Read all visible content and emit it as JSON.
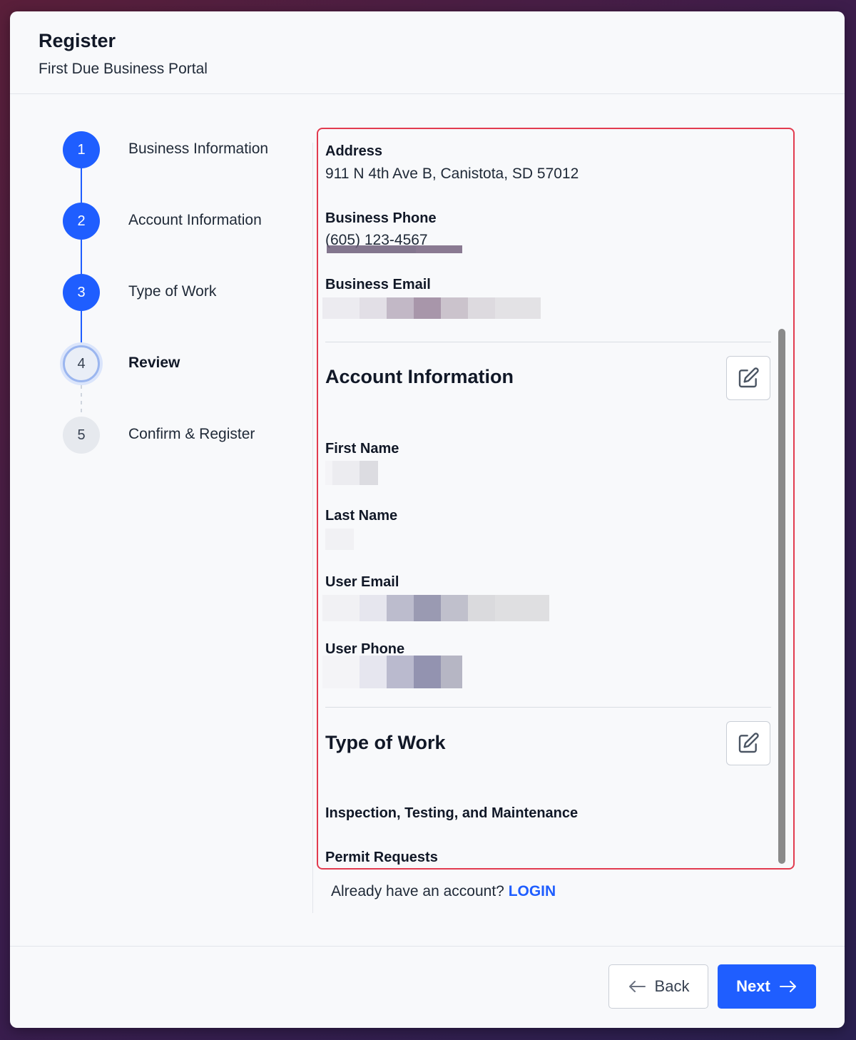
{
  "header": {
    "title": "Register",
    "subtitle": "First Due Business Portal"
  },
  "stepper": {
    "steps": [
      {
        "number": "1",
        "label": "Business Information",
        "state": "done"
      },
      {
        "number": "2",
        "label": "Account Information",
        "state": "done"
      },
      {
        "number": "3",
        "label": "Type of Work",
        "state": "done"
      },
      {
        "number": "4",
        "label": "Review",
        "state": "current"
      },
      {
        "number": "5",
        "label": "Confirm & Register",
        "state": "future"
      }
    ]
  },
  "review": {
    "business": {
      "address_label": "Address",
      "address_value": "911 N 4th Ave B, Canistota, SD 57012",
      "phone_label": "Business Phone",
      "phone_value": "(605) 123-4567",
      "email_label": "Business Email"
    },
    "account": {
      "title": "Account Information",
      "first_name_label": "First Name",
      "last_name_label": "Last Name",
      "user_email_label": "User Email",
      "user_phone_label": "User Phone"
    },
    "work": {
      "title": "Type of Work",
      "item1": "Inspection, Testing, and Maintenance",
      "item2": "Permit Requests"
    }
  },
  "login": {
    "prompt": "Already have an account?",
    "link": "LOGIN"
  },
  "footer": {
    "back_label": "Back",
    "next_label": "Next"
  },
  "colors": {
    "primary": "#1f5eff",
    "highlight_border": "#e23b4f"
  },
  "icons": {
    "edit": "edit-icon",
    "back": "arrow-left-icon",
    "next": "arrow-right-icon"
  }
}
